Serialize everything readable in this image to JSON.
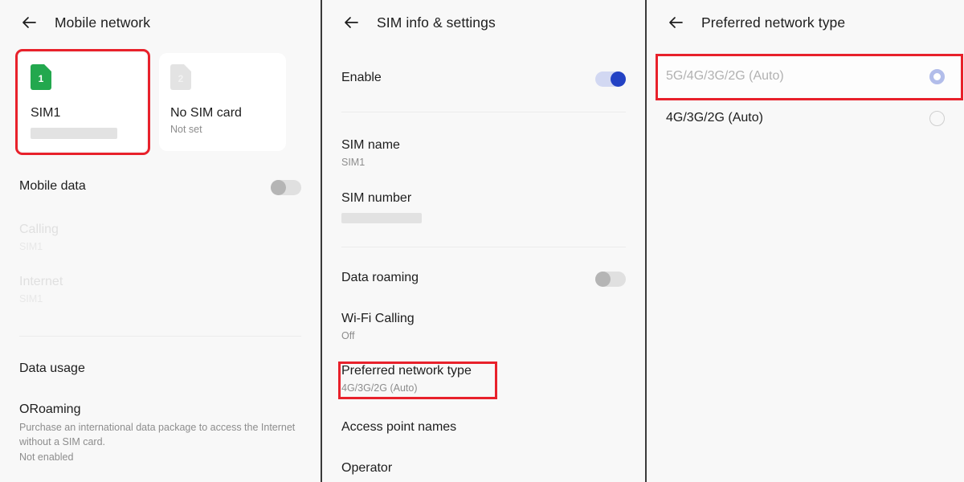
{
  "panel1": {
    "title": "Mobile network",
    "back_icon": "back-arrow-icon",
    "sim_cards": [
      {
        "badge": "1",
        "name": "SIM1",
        "sub": "",
        "redacted": true,
        "highlighted": true,
        "color": "#23a84e"
      },
      {
        "badge": "2",
        "name": "No SIM card",
        "sub": "Not set",
        "redacted": false,
        "highlighted": false,
        "color": "#e3e3e3"
      }
    ],
    "mobile_data": {
      "label": "Mobile data",
      "toggle": "off"
    },
    "calling": {
      "label": "Calling",
      "value": "SIM1",
      "disabled": true
    },
    "internet": {
      "label": "Internet",
      "value": "SIM1",
      "disabled": true
    },
    "data_usage": {
      "label": "Data usage"
    },
    "oroaming": {
      "label": "ORoaming",
      "body": "Purchase an international data package to access the Internet without a SIM card.",
      "status": "Not enabled"
    }
  },
  "panel2": {
    "title": "SIM info & settings",
    "back_icon": "back-arrow-icon",
    "enable": {
      "label": "Enable",
      "toggle": "on"
    },
    "sim_name": {
      "label": "SIM name",
      "value": "SIM1"
    },
    "sim_number": {
      "label": "SIM number",
      "value": "",
      "redacted": true
    },
    "data_roaming": {
      "label": "Data roaming",
      "toggle": "off"
    },
    "wifi_calling": {
      "label": "Wi-Fi Calling",
      "value": "Off"
    },
    "preferred_network_type": {
      "label": "Preferred network type",
      "value": "4G/3G/2G (Auto)",
      "highlighted": true
    },
    "access_point_names": {
      "label": "Access point names"
    },
    "operator": {
      "label": "Operator"
    }
  },
  "panel3": {
    "title": "Preferred network type",
    "back_icon": "back-arrow-icon",
    "options": [
      {
        "label": "5G/4G/3G/2G (Auto)",
        "selected": true,
        "highlighted": true
      },
      {
        "label": "4G/3G/2G (Auto)",
        "selected": false,
        "highlighted": false
      }
    ]
  },
  "colors": {
    "accent_blue": "#2342c4",
    "highlight_red": "#e8212b",
    "sim1_green": "#23a84e",
    "background": "#f8f8f8",
    "card": "#ffffff"
  }
}
